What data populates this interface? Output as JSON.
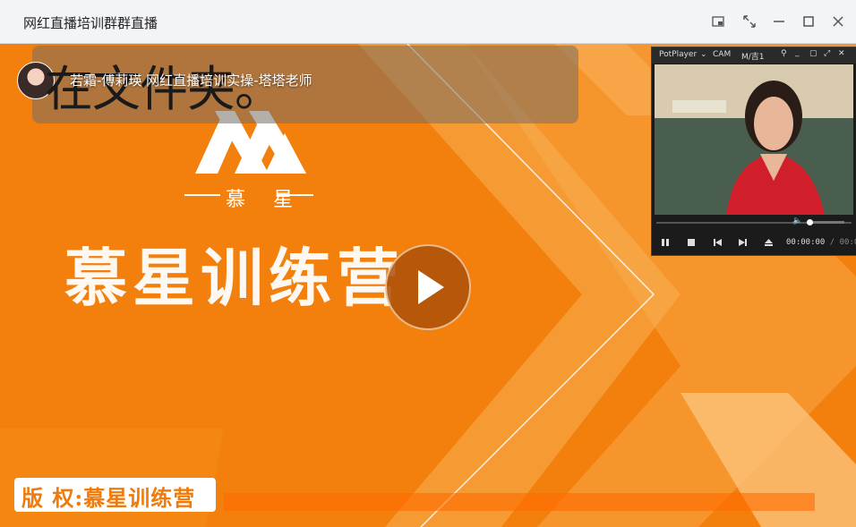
{
  "window": {
    "title": "网红直播培训群群直播"
  },
  "titlebar_buttons": [
    "pip-icon",
    "fullscreen-icon",
    "minimize-icon",
    "maximize-icon",
    "close-icon"
  ],
  "stream": {
    "caption": "若霜-傅莉瑛 网红直播培训实操-塔塔老师",
    "overlay_text": "在文件夹。",
    "logo_sub": "慕 星",
    "main_title": "慕星训练营",
    "copyright": "版 权:慕星训练营"
  },
  "potplayer": {
    "app_name": "PotPlayer",
    "tab_cam": "CAM",
    "tab_m4": "M/吉1",
    "time_current": "00:00:00",
    "time_separator": "/",
    "time_total": "00:00:00"
  },
  "colors": {
    "accent": "#f37f0c",
    "titlebar": "#f3f4f6"
  }
}
